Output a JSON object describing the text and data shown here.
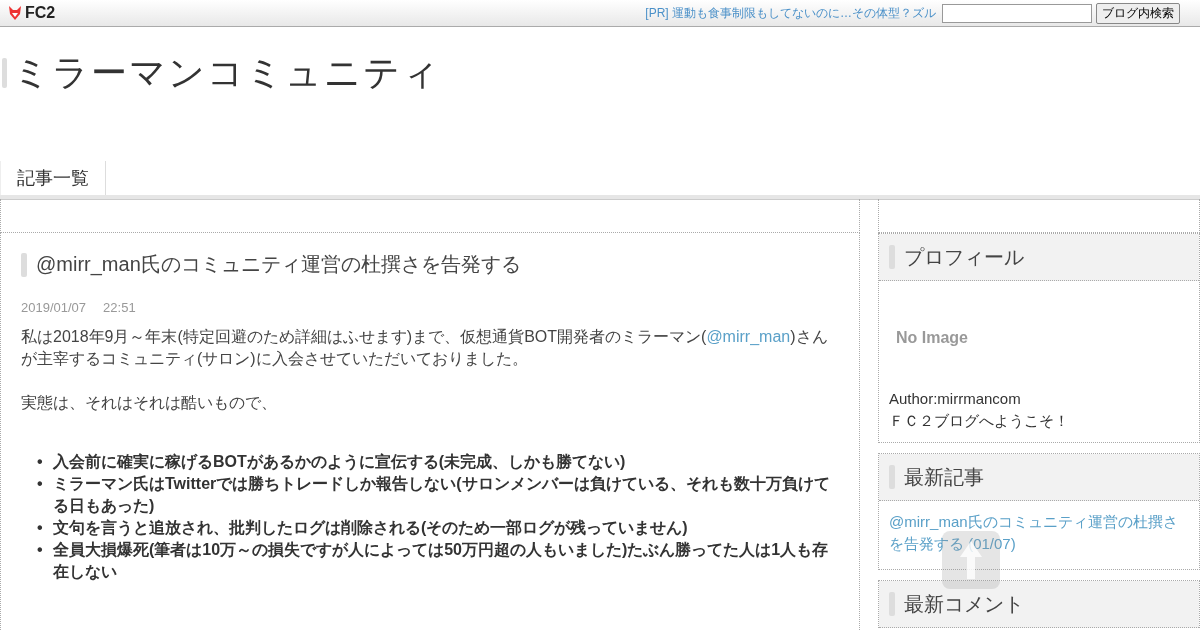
{
  "topbar": {
    "logo": "FC2",
    "ad_link": "[PR] 運動も食事制限もしてないのに…その体型？ズル",
    "search_button": "ブログ内検索"
  },
  "blog_title": "ミラーマンコミュニティ",
  "nav": [
    {
      "label": "記事一覧",
      "selected": true
    }
  ],
  "article": {
    "title": "@mirr_man氏のコミュニティ運営の杜撰さを告発する",
    "date": "2019/01/07",
    "time": "22:51",
    "intro": "私は2018年9月～年末(特定回避のため詳細はふせます)まで、仮想通貨BOT開発者のミラーマン(",
    "intro_link": "@mirr_man",
    "intro_end": ")さんが主宰するコミュニティ(サロン)に入会させていただいておりました。",
    "para2": "実態は、それはそれは酷いもので、",
    "bullets": [
      {
        "marker": "•",
        "text": "入会前に確実に稼げるBOTがあるかのように宣伝する(未完成、しかも勝てない)"
      },
      {
        "marker": "•",
        "text": "ミラーマン氏はTwitterでは勝ちトレードしか報告しない(サロンメンバーは負けている、それも数十万負けてる日もあった)"
      },
      {
        "marker": "•",
        "text": "文句を言うと追放され、批判したログは削除される(そのため一部ログが残っていません)"
      },
      {
        "marker": "•",
        "text": "全員大損爆死(筆者は10万～の損失ですが人によっては50万円超の人もいました)たぶん勝ってた人は1人も存在しない"
      }
    ]
  },
  "sidebar": {
    "profile": {
      "heading": "プロフィール",
      "image_text": "No Image",
      "author": "Author:mirrmancom",
      "welcome": "ＦＣ２ブログへようこそ！"
    },
    "recent_posts": {
      "heading": "最新記事",
      "items": [
        "@mirr_man氏のコミュニティ運営の杜撰さを告発する (01/07)"
      ]
    },
    "recent_comments": {
      "heading": "最新コメント"
    }
  }
}
